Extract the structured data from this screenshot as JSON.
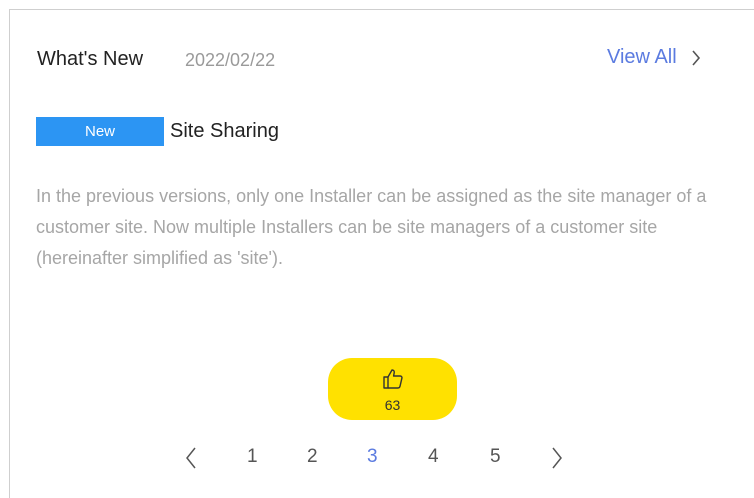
{
  "header": {
    "title": "What's New",
    "date": "2022/02/22",
    "view_all": "View All"
  },
  "news": {
    "tag": "New",
    "title": "Site Sharing",
    "body": "In the previous versions, only one Installer can be assigned as the site manager of a customer site. Now multiple Installers can be site managers of a customer site (hereinafter simplified as 'site')."
  },
  "like": {
    "count": "63",
    "icon": "thumbs-up-icon"
  },
  "pagination": {
    "pages": [
      "1",
      "2",
      "3",
      "4",
      "5"
    ],
    "current": "3"
  },
  "colors": {
    "accent": "#5b7be0",
    "tag": "#2c95f3",
    "like_button": "#ffe100",
    "body_text": "#a6a6a6"
  }
}
